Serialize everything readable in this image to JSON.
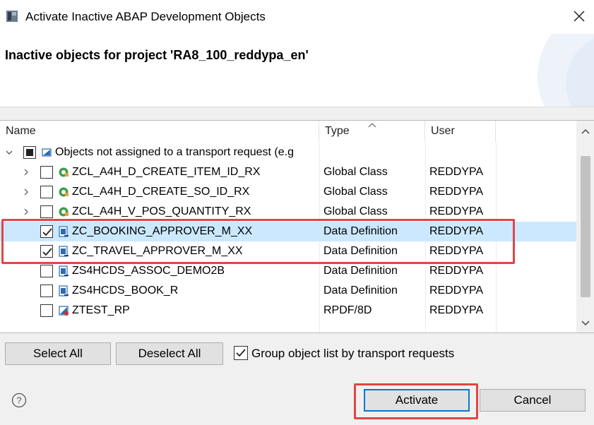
{
  "window": {
    "title": "Activate Inactive ABAP Development Objects"
  },
  "header": {
    "title": "Inactive objects for project 'RA8_100_reddypa_en'"
  },
  "table": {
    "columns": {
      "name": "Name",
      "type": "Type",
      "user": "User"
    },
    "group": {
      "label": "Objects not assigned to a transport request (e.g",
      "check_state": "partial"
    },
    "rows": [
      {
        "name": "ZCL_A4H_D_CREATE_ITEM_ID_RX",
        "type": "Global Class",
        "user": "REDDYPA",
        "icon": "global-class-icon",
        "checked": false,
        "expandable": true,
        "selected": false
      },
      {
        "name": "ZCL_A4H_D_CREATE_SO_ID_RX",
        "type": "Global Class",
        "user": "REDDYPA",
        "icon": "global-class-icon",
        "checked": false,
        "expandable": true,
        "selected": false
      },
      {
        "name": "ZCL_A4H_V_POS_QUANTITY_RX",
        "type": "Global Class",
        "user": "REDDYPA",
        "icon": "global-class-icon",
        "checked": false,
        "expandable": true,
        "selected": false
      },
      {
        "name": "ZC_BOOKING_APPROVER_M_XX",
        "type": "Data Definition",
        "user": "REDDYPA",
        "icon": "data-definition-icon",
        "checked": true,
        "expandable": false,
        "selected": true
      },
      {
        "name": "ZC_TRAVEL_APPROVER_M_XX",
        "type": "Data Definition",
        "user": "REDDYPA",
        "icon": "data-definition-icon",
        "checked": true,
        "expandable": false,
        "selected": false
      },
      {
        "name": "ZS4HCDS_ASSOC_DEMO2B",
        "type": "Data Definition",
        "user": "REDDYPA",
        "icon": "data-definition-icon",
        "checked": false,
        "expandable": false,
        "selected": false
      },
      {
        "name": "ZS4HCDS_BOOK_R",
        "type": "Data Definition",
        "user": "REDDYPA",
        "icon": "data-definition-icon",
        "checked": false,
        "expandable": false,
        "selected": false
      },
      {
        "name": "ZTEST_RP",
        "type": "RPDF/8D",
        "user": "REDDYPA",
        "icon": "rpdf-icon",
        "checked": false,
        "expandable": false,
        "selected": false
      }
    ]
  },
  "buttons": {
    "select_all": "Select All",
    "deselect_all": "Deselect All",
    "activate": "Activate",
    "cancel": "Cancel"
  },
  "group_option": {
    "label": "Group object list by transport requests",
    "checked": true
  },
  "colors": {
    "selection": "#cce8ff",
    "highlight": "#e04646",
    "primary_border": "#0078d7"
  }
}
